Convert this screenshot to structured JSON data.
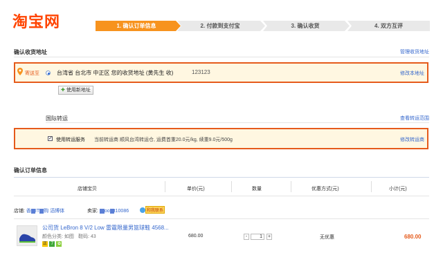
{
  "logo": {
    "text": "淘宝网"
  },
  "steps": [
    {
      "label": "1. 确认订单信息"
    },
    {
      "label": "2. 付款到支付宝"
    },
    {
      "label": "3. 确认收货"
    },
    {
      "label": "4. 双方互评"
    }
  ],
  "address_section": {
    "title": "确认收货地址",
    "manage_link": "管理收货地址",
    "send_to": "寄送至",
    "address_text": "台湾省 台北市 中正区 您的收货地址 (黄先生 收)",
    "phone": "123123",
    "edit_link": "修改本地址",
    "new_address_button": "使用新地址"
  },
  "shipping_section": {
    "title": "国际转运",
    "view_link": "查看转运范围",
    "service_label": "使用转运服务",
    "service_desc": "当前转运商 顺风台湾转运仓, 运费首重20.0元/kg, 续重9.0元/500g",
    "edit_link": "修改转运商"
  },
  "order_section": {
    "title": "确认订单信息",
    "columns": [
      "店铺宝贝",
      "单价(元)",
      "数量",
      "优惠方式(元)",
      "小计(元)"
    ],
    "shop_label": "店铺:",
    "shop_name_a": "香",
    "shop_name_b": "IT",
    "shop_name_c": "购",
    "shop_name_d": "滔博体",
    "seller_label": "卖家:",
    "seller_name_a": "",
    "seller_name_b": "oo",
    "seller_name_c": "t10086",
    "contact_label": "和我联系",
    "item": {
      "title": "公司货 LeBron 8 V/2 Low 雷霆限量男篮球鞋 4568...",
      "color_label": "颜色分类: 如图",
      "size_label": "鞋码: 43",
      "price": "680.00",
      "quantity": "1",
      "discount": "无优惠",
      "subtotal": "680.00",
      "minus": "-",
      "plus": "+"
    }
  },
  "colors": {
    "brand": "#ff4400",
    "accent": "#e55a1b",
    "link": "#3366cc",
    "box_bg": "#fff7e1"
  }
}
